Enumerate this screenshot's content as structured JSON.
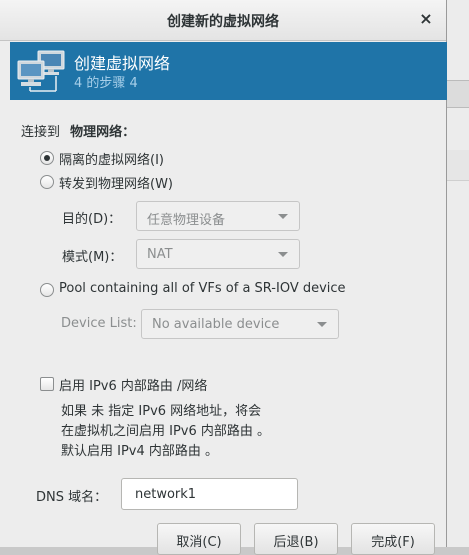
{
  "dialog": {
    "title": "创建新的虚拟网络",
    "close_glyph": "×"
  },
  "banner": {
    "title": "创建虚拟网络",
    "step": "4 的步骤 4",
    "icon": "network-computers-icon"
  },
  "connect": {
    "prefix": "连接到",
    "target": "物理网络："
  },
  "options": {
    "isolated": "隔离的虚拟网络(I)",
    "forward": "转发到物理网络(W)",
    "sriov": "Pool containing all of VFs of a SR-IOV device"
  },
  "forward_settings": {
    "dest_label": "目的(D)：",
    "dest_value": "任意物理设备",
    "mode_label": "模式(M)：",
    "mode_value": "NAT"
  },
  "sriov_settings": {
    "device_list_label": "Device List:",
    "device_list_value": "No available device"
  },
  "ipv6": {
    "label": "启用  IPv6 内部路由 /网络",
    "help_line1": "如果  未  指定  IPv6 网络地址，将会",
    "help_line2": "在虚拟机之间启用  IPv6 内部路由 。",
    "help_line3": "默认启用  IPv4 内部路由 。"
  },
  "dns": {
    "label": "DNS 域名：",
    "value": "network1"
  },
  "buttons": {
    "cancel": "取消(C)",
    "back": "后退(B)",
    "finish": "完成(F)"
  },
  "colors": {
    "banner": "#1f74a8",
    "banner_sub": "#a7cfe9",
    "dialog_bg": "#ededed"
  }
}
